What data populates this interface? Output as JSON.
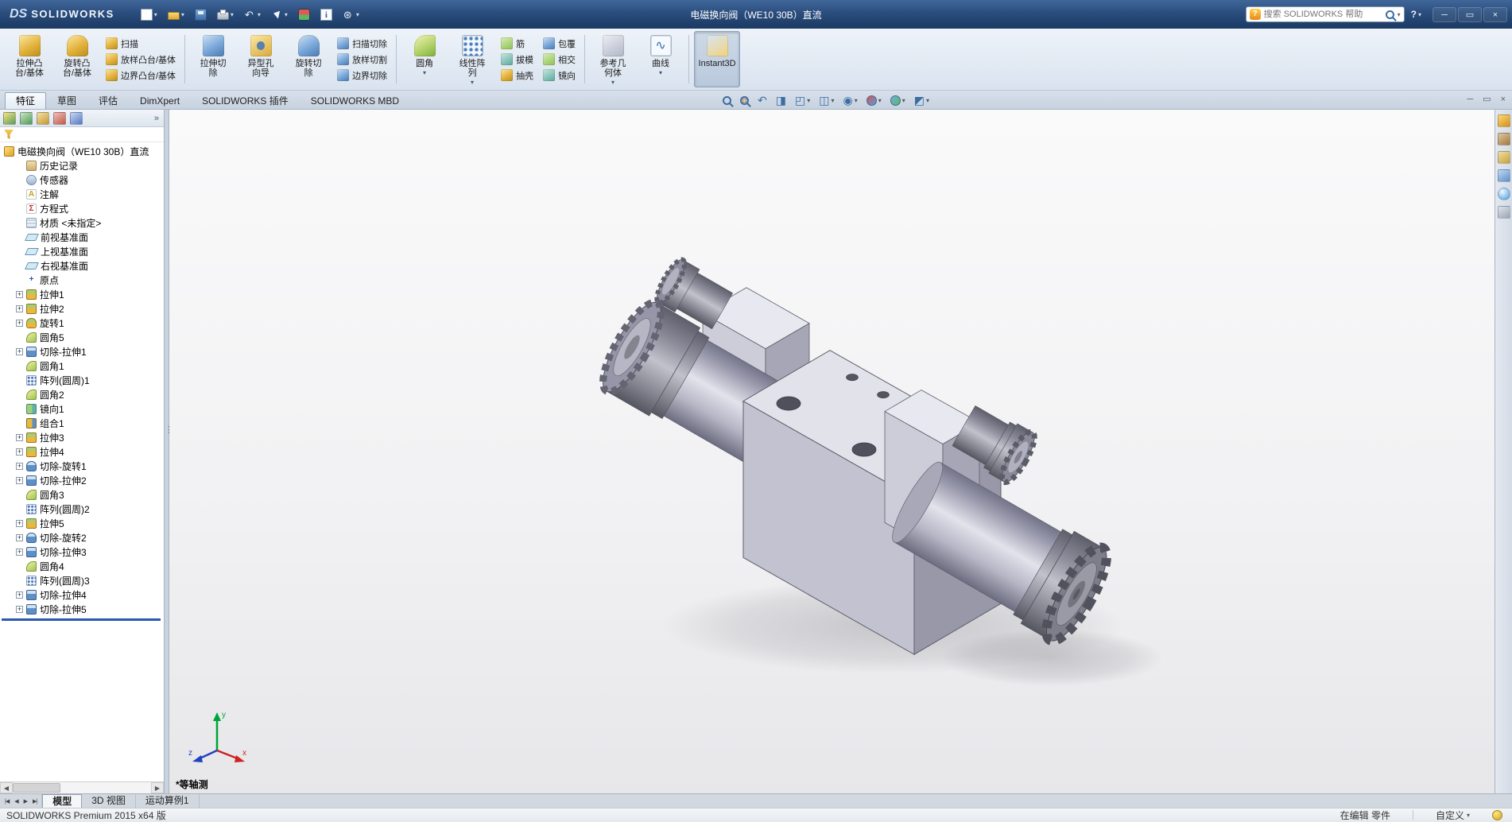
{
  "icons": {
    "caret": "▾",
    "expander": "+"
  },
  "titlebar": {
    "logo_mark": "DS",
    "logo_text": "SOLIDWORKS",
    "document_title": "电磁换向阀（WE10 30B）直流",
    "search_placeholder": "搜索 SOLIDWORKS 帮助",
    "search_logo_glyph": "?",
    "help_glyph": "?",
    "quick_tools": [
      {
        "name": "new",
        "caret": true
      },
      {
        "name": "open",
        "caret": true
      },
      {
        "name": "save",
        "caret": false
      },
      {
        "name": "print",
        "caret": true
      },
      {
        "name": "undo",
        "caret": true
      },
      {
        "name": "select",
        "caret": true
      },
      {
        "name": "rebuild",
        "caret": false
      },
      {
        "name": "file-properties",
        "caret": false
      },
      {
        "name": "options",
        "caret": true
      }
    ],
    "window_controls": [
      {
        "name": "minimize",
        "glyph": "─"
      },
      {
        "name": "maximize",
        "glyph": "▭"
      },
      {
        "name": "close",
        "glyph": "×"
      }
    ]
  },
  "ribbon": {
    "cells": [
      {
        "kind": "big",
        "name": "extruded-boss-base",
        "icon": "extrude-boss",
        "tone": "gold",
        "label": "拉伸凸\n台/基体"
      },
      {
        "kind": "big",
        "name": "revolved-boss-base",
        "icon": "revolve-boss",
        "tone": "gold-round",
        "label": "旋转凸\n台/基体"
      },
      {
        "kind": "stack",
        "items": [
          {
            "name": "swept-boss-base",
            "icon": "sweep",
            "tone": "gold",
            "label": "扫描"
          },
          {
            "name": "lofted-boss-base",
            "icon": "loft",
            "tone": "gold",
            "label": "放样凸台/基体"
          },
          {
            "name": "boundary-boss-base",
            "icon": "boundary",
            "tone": "gold",
            "label": "边界凸台/基体"
          }
        ]
      },
      {
        "kind": "sep"
      },
      {
        "kind": "big",
        "name": "extruded-cut",
        "icon": "extrude-cut",
        "tone": "blue",
        "label": "拉伸切\n除"
      },
      {
        "kind": "big",
        "name": "hole-wizard",
        "icon": "hole-wizard",
        "tone": "hole",
        "label": "异型孔\n向导"
      },
      {
        "kind": "big",
        "name": "revolved-cut",
        "icon": "revolve-cut",
        "tone": "blue-round",
        "label": "旋转切\n除"
      },
      {
        "kind": "stack",
        "items": [
          {
            "name": "swept-cut",
            "icon": "sweep-cut",
            "tone": "blue",
            "label": "扫描切除"
          },
          {
            "name": "lofted-cut",
            "icon": "loft-cut",
            "tone": "blue",
            "label": "放样切割"
          },
          {
            "name": "boundary-cut",
            "icon": "boundary-cut",
            "tone": "blue",
            "label": "边界切除"
          }
        ]
      },
      {
        "kind": "sep"
      },
      {
        "kind": "big",
        "name": "fillet",
        "icon": "fillet",
        "tone": "fillet",
        "label": "圆角",
        "caret": true
      },
      {
        "kind": "big",
        "name": "linear-pattern",
        "icon": "linear-pattern",
        "tone": "dots",
        "label": "线性阵\n列",
        "caret": true
      },
      {
        "kind": "stack",
        "items": [
          {
            "name": "rib",
            "icon": "rib",
            "tone": "green",
            "label": "筋"
          },
          {
            "name": "draft",
            "icon": "draft",
            "tone": "teal",
            "label": "拔模"
          },
          {
            "name": "shell",
            "icon": "shell",
            "tone": "gold",
            "label": "抽壳"
          }
        ]
      },
      {
        "kind": "stack",
        "items": [
          {
            "name": "wrap",
            "icon": "wrap",
            "tone": "blue",
            "label": "包覆"
          },
          {
            "name": "intersect",
            "icon": "intersect",
            "tone": "green",
            "label": "相交"
          },
          {
            "name": "mirror",
            "icon": "mirror",
            "tone": "teal",
            "label": "镜向"
          }
        ]
      },
      {
        "kind": "sep"
      },
      {
        "kind": "big",
        "name": "reference-geometry",
        "icon": "reference-geometry",
        "tone": "gray",
        "label": "参考几\n何体",
        "caret": true
      },
      {
        "kind": "big",
        "name": "curves",
        "icon": "curves",
        "tone": "curve",
        "label": "曲线",
        "caret": true
      },
      {
        "kind": "sep"
      },
      {
        "kind": "big",
        "name": "instant3d",
        "icon": "instant3d",
        "tone": "instant",
        "label": "Instant3D",
        "pressed": true
      }
    ]
  },
  "command_tabs": [
    {
      "name": "features",
      "label": "特征",
      "active": true
    },
    {
      "name": "sketch",
      "label": "草图",
      "active": false
    },
    {
      "name": "evaluate",
      "label": "评估",
      "active": false
    },
    {
      "name": "dimxpert",
      "label": "DimXpert",
      "active": false
    },
    {
      "name": "solidworks-add-ins",
      "label": "SOLIDWORKS 插件",
      "active": false
    },
    {
      "name": "solidworks-mbd",
      "label": "SOLIDWORKS MBD",
      "active": false
    }
  ],
  "headsup": [
    {
      "name": "zoom-fit",
      "kind": "mag"
    },
    {
      "name": "zoom-area",
      "kind": "mag-area"
    },
    {
      "name": "previous-view",
      "kind": "text",
      "glyph": "↶"
    },
    {
      "name": "section-view",
      "kind": "text",
      "glyph": "◨"
    },
    {
      "name": "view-orientation",
      "kind": "text",
      "glyph": "◰",
      "caret": true
    },
    {
      "name": "display-style",
      "kind": "text",
      "glyph": "◫",
      "caret": true
    },
    {
      "name": "hide-show-items",
      "kind": "text",
      "glyph": "◉",
      "caret": true
    },
    {
      "name": "edit-appearance",
      "kind": "ball",
      "colors": [
        "#e05050",
        "#50a0e0"
      ],
      "caret": true
    },
    {
      "name": "apply-scene",
      "kind": "ball",
      "colors": [
        "#70b0e8",
        "#58b858"
      ],
      "caret": true
    },
    {
      "name": "view-settings",
      "kind": "text",
      "glyph": "◩",
      "caret": true
    }
  ],
  "doc_window_controls": [
    {
      "name": "doc-minimize",
      "glyph": "─"
    },
    {
      "name": "doc-restore",
      "glyph": "▭"
    },
    {
      "name": "doc-close",
      "glyph": "×"
    }
  ],
  "manager_tabs": [
    {
      "name": "featuremanager-tab"
    },
    {
      "name": "propertymanager-tab"
    },
    {
      "name": "configurationmanager-tab"
    },
    {
      "name": "dimxpertmanager-tab"
    },
    {
      "name": "displaymanager-tab"
    }
  ],
  "manager_overflow": "»",
  "tree": {
    "items": [
      {
        "label": "电磁换向阀（WE10 30B）直流",
        "icon": "part",
        "root": true
      },
      {
        "label": "历史记录",
        "icon": "history"
      },
      {
        "label": "传感器",
        "icon": "sensors"
      },
      {
        "label": "注解",
        "icon": "annotations"
      },
      {
        "label": "方程式",
        "icon": "equations"
      },
      {
        "label": "材质 <未指定>",
        "icon": "material"
      },
      {
        "label": "前视基准面",
        "icon": "plane"
      },
      {
        "label": "上视基准面",
        "icon": "plane"
      },
      {
        "label": "右视基准面",
        "icon": "plane"
      },
      {
        "label": "原点",
        "icon": "origin"
      },
      {
        "label": "拉伸1",
        "icon": "extrude",
        "expand": true
      },
      {
        "label": "拉伸2",
        "icon": "extrude",
        "expand": true
      },
      {
        "label": "旋转1",
        "icon": "revolve",
        "expand": true
      },
      {
        "label": "圆角5",
        "icon": "fillet"
      },
      {
        "label": "切除-拉伸1",
        "icon": "cut-extrude",
        "expand": true
      },
      {
        "label": "圆角1",
        "icon": "fillet"
      },
      {
        "label": "阵列(圆周)1",
        "icon": "pattern"
      },
      {
        "label": "圆角2",
        "icon": "fillet"
      },
      {
        "label": "镜向1",
        "icon": "mirror"
      },
      {
        "label": "组合1",
        "icon": "combine"
      },
      {
        "label": "拉伸3",
        "icon": "extrude",
        "expand": true
      },
      {
        "label": "拉伸4",
        "icon": "extrude",
        "expand": true
      },
      {
        "label": "切除-旋转1",
        "icon": "cut-revolve",
        "expand": true
      },
      {
        "label": "切除-拉伸2",
        "icon": "cut-extrude",
        "expand": true
      },
      {
        "label": "圆角3",
        "icon": "fillet"
      },
      {
        "label": "阵列(圆周)2",
        "icon": "pattern"
      },
      {
        "label": "拉伸5",
        "icon": "extrude",
        "expand": true
      },
      {
        "label": "切除-旋转2",
        "icon": "cut-revolve",
        "expand": true
      },
      {
        "label": "切除-拉伸3",
        "icon": "cut-extrude",
        "expand": true
      },
      {
        "label": "圆角4",
        "icon": "fillet"
      },
      {
        "label": "阵列(圆周)3",
        "icon": "pattern"
      },
      {
        "label": "切除-拉伸4",
        "icon": "cut-extrude",
        "expand": true
      },
      {
        "label": "切除-拉伸5",
        "icon": "cut-extrude",
        "expand": true
      }
    ]
  },
  "viewport": {
    "view_label": "*等轴测",
    "triad_axes": [
      "x",
      "y",
      "z"
    ]
  },
  "taskpane": [
    {
      "name": "solidworks-resources"
    },
    {
      "name": "design-library"
    },
    {
      "name": "file-explorer"
    },
    {
      "name": "view-palette"
    },
    {
      "name": "appearances-scenes"
    },
    {
      "name": "custom-properties"
    }
  ],
  "bottom_tabs": {
    "nav": [
      {
        "name": "first",
        "glyph": "|◀"
      },
      {
        "name": "prev",
        "glyph": "◀"
      },
      {
        "name": "next",
        "glyph": "▶"
      },
      {
        "name": "last",
        "glyph": "▶|"
      }
    ],
    "tabs": [
      {
        "name": "model",
        "label": "模型",
        "active": true
      },
      {
        "name": "3d-views",
        "label": "3D 视图",
        "active": false
      },
      {
        "name": "motion-study-1",
        "label": "运动算例1",
        "active": false
      }
    ]
  },
  "statusbar": {
    "product": "SOLIDWORKS Premium 2015 x64 版",
    "editing_state": "在编辑 零件",
    "custom_label": "自定义"
  }
}
